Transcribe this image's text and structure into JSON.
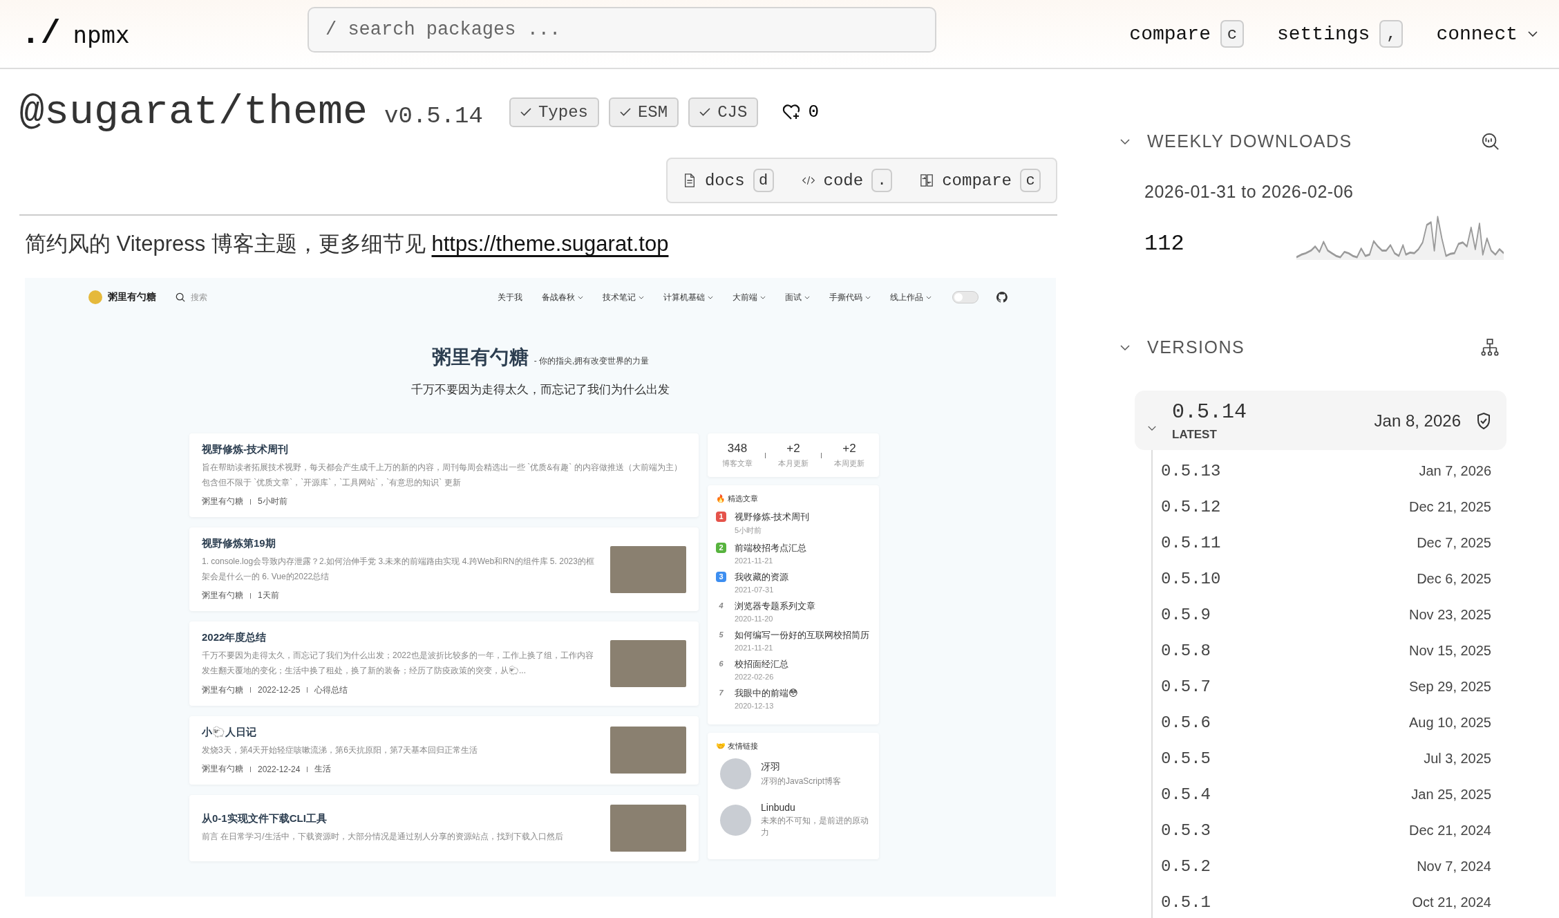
{
  "header": {
    "logo_mark": "./",
    "site_name": "npmx",
    "search": {
      "placeholder": "/ search packages ..."
    },
    "nav": [
      {
        "label": "compare",
        "kind": "shortcut",
        "key": "c"
      },
      {
        "label": "settings",
        "kind": "shortcut",
        "key": ","
      },
      {
        "label": "connect",
        "kind": "dropdown"
      }
    ]
  },
  "package": {
    "name": "@sugarat/theme",
    "version": "v0.5.14",
    "badges": [
      {
        "label": "Types",
        "checked": true
      },
      {
        "label": "ESM",
        "checked": true
      },
      {
        "label": "CJS",
        "checked": true
      }
    ],
    "likes": "0",
    "actions": [
      {
        "kind": "docs",
        "label": "docs",
        "key": "d"
      },
      {
        "kind": "code",
        "label": "code",
        "key": "."
      },
      {
        "kind": "compare",
        "label": "compare",
        "key": "c"
      }
    ],
    "description": "简约风的 Vitepress 博客主题，更多细节见",
    "homepage": "https://theme.sugarat.top"
  },
  "readme_screenshot": {
    "site_name": "粥里有勺糖",
    "search_placeholder": "搜索",
    "nav": [
      {
        "label": "关于我",
        "dropdown": false
      },
      {
        "label": "备战春秋",
        "dropdown": true
      },
      {
        "label": "技术笔记",
        "dropdown": true
      },
      {
        "label": "计算机基础",
        "dropdown": true
      },
      {
        "label": "大前端",
        "dropdown": true
      },
      {
        "label": "面试",
        "dropdown": true
      },
      {
        "label": "手撕代码",
        "dropdown": true
      },
      {
        "label": "线上作品",
        "dropdown": true
      }
    ],
    "theme_toggle": {
      "on": false
    },
    "hero_title": "粥里有勺糖",
    "hero_tagline": "- 你的指尖,拥有改变世界的力量",
    "hero_subtitle": "千万不要因为走得太久，而忘记了我们为什么出发",
    "posts": [
      {
        "title": "视野修炼-技术周刊",
        "excerpt": "旨在帮助读者拓展技术视野，每天都会产生成千上万的新的内容，周刊每周会精选出一些 `优质&有趣` 的内容做推送（大前端为主）包含但不限于 `优质文章`，`开源库`，`工具网站`，`有意思的知识` 更新",
        "meta": [
          "粥里有勺糖",
          "5小时前"
        ],
        "thumbnail": false
      },
      {
        "title": "视野修炼第19期",
        "excerpt": "1. console.log会导致内存泄露？2.如何治伸手党 3.未来的前端路由实现 4.跨Web和RN的组件库 5. 2023的框架会是什么一的 6. Vue的2022总结",
        "meta": [
          "粥里有勺糖",
          "1天前"
        ],
        "thumbnail": true
      },
      {
        "title": "2022年度总结",
        "excerpt": "千万不要因为走得太久，而忘记了我们为什么出发；2022也是波折比较多的一年，工作上换了组，工作内容发生翻天覆地的变化；生活中换了租处，换了新的装备；经历了防疫政策的突变，从🐑...",
        "meta": [
          "粥里有勺糖",
          "2022-12-25",
          "心得总结"
        ],
        "thumbnail": true
      },
      {
        "title": "小🐑人日记",
        "excerpt": "发烧3天，第4天开始轻症咳嗽流涕，第6天抗原阳，第7天基本回归正常生活",
        "meta": [
          "粥里有勺糖",
          "2022-12-24",
          "生活"
        ],
        "thumbnail": true
      },
      {
        "title": "从0-1实现文件下载CLI工具",
        "excerpt": "前言 在日常学习/生活中，下载资源时，大部分情况是通过别人分享的资源站点，找到下载入口然后",
        "thumbnail": true
      }
    ],
    "stats": [
      {
        "value": "348",
        "label": "博客文章"
      },
      {
        "value": "+2",
        "label": "本月更新"
      },
      {
        "value": "+2",
        "label": "本周更新"
      }
    ],
    "featured_title": "🔥 精选文章",
    "featured": [
      {
        "rank": "1",
        "title": "视野修炼-技术周刊",
        "date": "5小时前",
        "color": "#e5534b"
      },
      {
        "rank": "2",
        "title": "前端校招考点汇总",
        "date": "2021-11-21",
        "color": "#57b33e"
      },
      {
        "rank": "3",
        "title": "我收藏的资源",
        "date": "2021-07-31",
        "color": "#3d8ef0"
      },
      {
        "rank": "4",
        "title": "浏览器专题系列文章",
        "date": "2020-11-20"
      },
      {
        "rank": "5",
        "title": "如何编写一份好的互联网校招简历",
        "date": "2021-11-21"
      },
      {
        "rank": "6",
        "title": "校招面经汇总",
        "date": "2022-02-26"
      },
      {
        "rank": "7",
        "title": "我眼中的前端😳",
        "date": "2020-12-13"
      }
    ],
    "friends_title": "🤝 友情链接",
    "friends": [
      {
        "name": "冴羽",
        "desc": "冴羽的JavaScript博客"
      },
      {
        "name": "Linbudu",
        "desc": "未来的不可知，是前进的原动力"
      }
    ]
  },
  "weekly_downloads": {
    "title": "WEEKLY DOWNLOADS",
    "expanded": true,
    "range": "2026-01-31 to 2026-02-06",
    "count": "112"
  },
  "versions": {
    "title": "VERSIONS",
    "expanded": true,
    "latest": {
      "version": "0.5.14",
      "tag": "LATEST",
      "date": "Jan 8, 2026",
      "expanded": true
    },
    "list": [
      {
        "version": "0.5.13",
        "date": "Jan 7, 2026"
      },
      {
        "version": "0.5.12",
        "date": "Dec 21, 2025"
      },
      {
        "version": "0.5.11",
        "date": "Dec 7, 2025"
      },
      {
        "version": "0.5.10",
        "date": "Dec 6, 2025"
      },
      {
        "version": "0.5.9",
        "date": "Nov 23, 2025"
      },
      {
        "version": "0.5.8",
        "date": "Nov 15, 2025"
      },
      {
        "version": "0.5.7",
        "date": "Sep 29, 2025"
      },
      {
        "version": "0.5.6",
        "date": "Aug 10, 2025"
      },
      {
        "version": "0.5.5",
        "date": "Jul 3, 2025"
      },
      {
        "version": "0.5.4",
        "date": "Jan 25, 2025"
      },
      {
        "version": "0.5.3",
        "date": "Dec 21, 2024"
      },
      {
        "version": "0.5.2",
        "date": "Nov 7, 2024"
      },
      {
        "version": "0.5.1",
        "date": "Oct 21, 2024"
      }
    ]
  }
}
